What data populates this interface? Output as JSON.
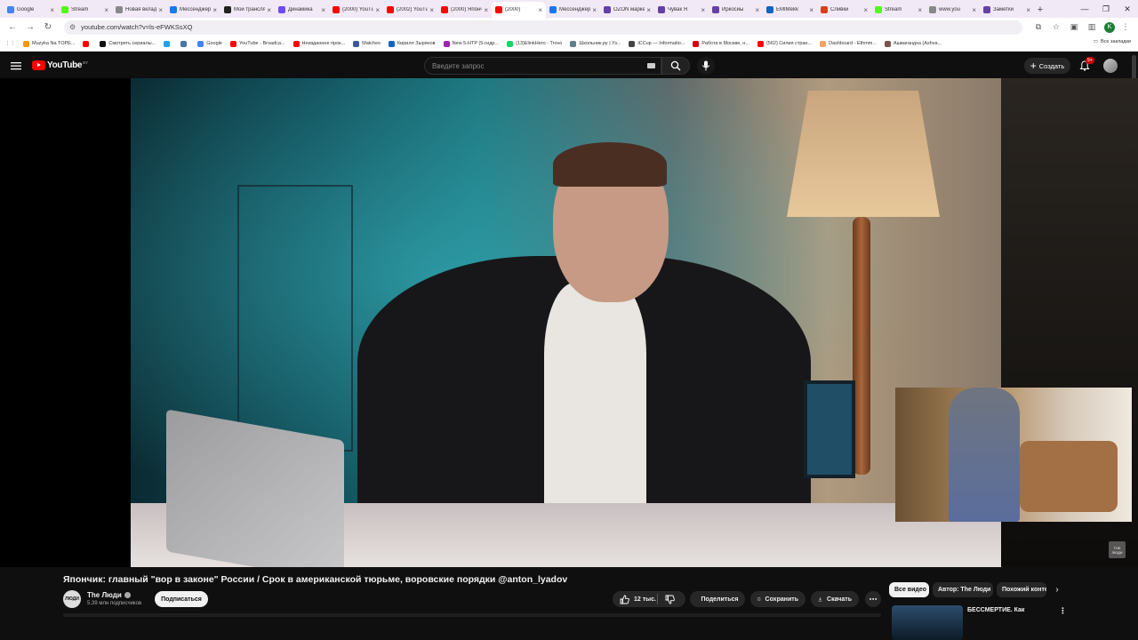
{
  "browser": {
    "tabs": [
      {
        "label": "Google",
        "color": "#4285f4"
      },
      {
        "label": "Stream",
        "color": "#53fc18"
      },
      {
        "label": "Новая вкладка",
        "color": "#888888"
      },
      {
        "label": "Мессенджер",
        "color": "#1877f2"
      },
      {
        "label": "Мои трансляции",
        "color": "#222222"
      },
      {
        "label": "Динамика",
        "color": "#6c4cf5"
      },
      {
        "label": "(2000) YouTube",
        "color": "#ff0000"
      },
      {
        "label": "(2002) YouTube",
        "color": "#ff0000"
      },
      {
        "label": "(2000) Япончик",
        "color": "#ff0000"
      },
      {
        "label": "(2000)",
        "color": "#ff0000",
        "active": true
      },
      {
        "label": "Мессенджер",
        "color": "#1877f2"
      },
      {
        "label": "OZON маркет",
        "color": "#6441a5"
      },
      {
        "label": "Чувак Я",
        "color": "#6441a5"
      },
      {
        "label": "Иркосиы",
        "color": "#6441a5"
      },
      {
        "label": "EMIMekk",
        "color": "#0a66c2"
      },
      {
        "label": "Сливки",
        "color": "#d84315"
      },
      {
        "label": "Stream",
        "color": "#53fc18"
      },
      {
        "label": "www.you",
        "color": "#888888"
      },
      {
        "label": "Заметки",
        "color": "#6441a5"
      }
    ],
    "new_tab": "+",
    "url": "youtube.com/watch?v=ls-eFWKSsXQ",
    "profile_initial": "K",
    "bookmarks": [
      {
        "label": "Muzyka Na TOPE...",
        "color": "#ff9800"
      },
      {
        "label": "",
        "color": "#ff0000"
      },
      {
        "label": "Смотреть сериалы...",
        "color": "#111111"
      },
      {
        "label": "",
        "color": "#1da1f2"
      },
      {
        "label": "",
        "color": "#4a76a8"
      },
      {
        "label": "Google",
        "color": "#4285f4"
      },
      {
        "label": "YouTube - Broadca...",
        "color": "#ff0000"
      },
      {
        "label": "Неизданное прок...",
        "color": "#ff0000"
      },
      {
        "label": "Matches",
        "color": "#3b5998"
      },
      {
        "label": "Кирилл Зырянов",
        "color": "#0a66c2"
      },
      {
        "label": "New 5-HTP (5-гидр...",
        "color": "#9c27b0"
      },
      {
        "label": "(13)ElinkHero - Trovo",
        "color": "#19d66b"
      },
      {
        "label": "Школьник.ру | Уз...",
        "color": "#607d8b"
      },
      {
        "label": "iCCup — Informatio...",
        "color": "#444444"
      },
      {
        "label": "Работа в Москве, н...",
        "color": "#d50000"
      },
      {
        "label": "(562) Силия стран...",
        "color": "#ff0000"
      },
      {
        "label": "Dashboard - Ethmm...",
        "color": "#f4a261"
      },
      {
        "label": "Ашвагандха (Ashva...",
        "color": "#795548"
      }
    ],
    "all_bookmarks": "Все закладки"
  },
  "youtube": {
    "logo_text": "YouTube",
    "logo_region": "BY",
    "search_placeholder": "Введите запрос",
    "create_label": "Создать",
    "notif_badge": "9+",
    "video_title": "Япончик: главный \"вор в законе\" России / Срок в американской тюрьме, воровские порядки @anton_lyadov",
    "channel_name": "The Люди",
    "channel_avatar_text": "ЛЮДИ",
    "subscribers": "5,39 млн подписчиков",
    "subscribe_label": "Подписаться",
    "likes": "12 тыс.",
    "share_label": "Поделиться",
    "save_label": "Сохранить",
    "download_label": "Скачать",
    "watermark": "THE ЛЮДИ",
    "chips": [
      {
        "label": "Все видео",
        "selected": true
      },
      {
        "label": "Автор: The Люди",
        "selected": false
      },
      {
        "label": "Похожий контент",
        "selected": false
      }
    ],
    "rec_title": "БЕССМЕРТИЕ. Как"
  }
}
